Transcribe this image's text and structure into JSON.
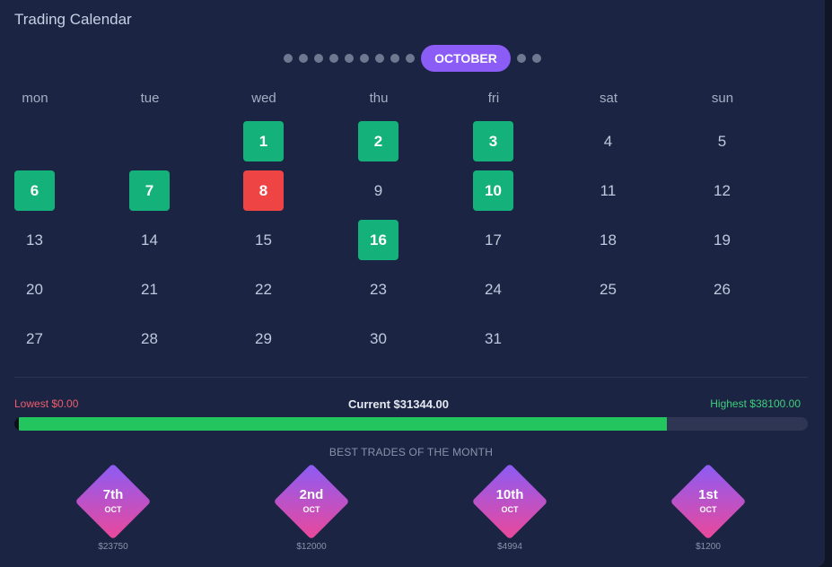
{
  "title": "Trading Calendar",
  "month_selector": {
    "selected": "OCTOBER",
    "dots_before": 9,
    "dots_after": 2
  },
  "weekdays": [
    "mon",
    "tue",
    "wed",
    "thu",
    "fri",
    "sat",
    "sun"
  ],
  "calendar": {
    "first_weekday_index": 2,
    "days_in_month": 31,
    "win_days": [
      1,
      2,
      3,
      6,
      7,
      10,
      16
    ],
    "loss_days": [
      8
    ]
  },
  "progress": {
    "lowest_label": "Lowest $0.00",
    "current_label": "Current $31344.00",
    "highest_label": "Highest $38100.00",
    "min": 0,
    "current": 31344,
    "max": 38100
  },
  "best_trades": {
    "title": "BEST TRADES OF THE MONTH",
    "items": [
      {
        "day": "7th",
        "month": "OCT",
        "amount": "$23750"
      },
      {
        "day": "2nd",
        "month": "OCT",
        "amount": "$12000"
      },
      {
        "day": "10th",
        "month": "OCT",
        "amount": "$4994"
      },
      {
        "day": "1st",
        "month": "OCT",
        "amount": "$1200"
      }
    ]
  },
  "colors": {
    "background": "#1c2443",
    "accent": "#8b5cf6",
    "win": "#14b27a",
    "loss": "#ef4444",
    "progress": "#22c55e"
  }
}
